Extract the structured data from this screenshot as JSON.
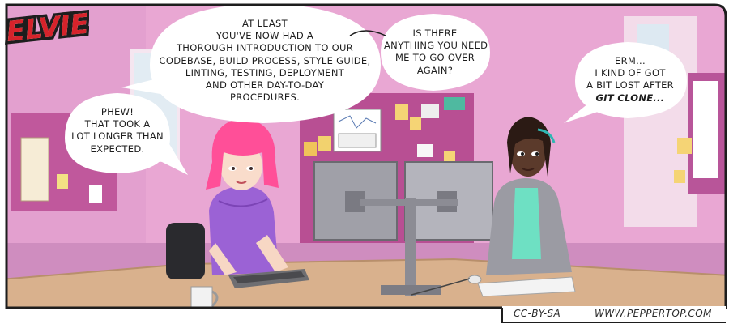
{
  "logo": {
    "text": "ELVIE",
    "color": "#d6232b"
  },
  "bubbles": {
    "elvie_phew": {
      "lines": [
        "Phew!",
        "That took a",
        "lot longer than",
        "expected."
      ]
    },
    "elvie_intro": {
      "lines": [
        "At least",
        "you've now had a",
        "thorough introduction to our",
        "codebase, build process, style guide,",
        "linting, testing, deployment",
        "and other day-to-day",
        "procedures."
      ]
    },
    "elvie_question": {
      "lines": [
        "Is there",
        "anything you need",
        "me to go over",
        "again?"
      ]
    },
    "colleague_reply": {
      "line1": "Erm...",
      "line2": "I kind of got",
      "line3": "a bit lost after",
      "line4_emph": "git clone..."
    }
  },
  "footer": {
    "license": "CC-BY-SA",
    "website": "www.peppertop.com"
  },
  "colors": {
    "wall": "#e6a1d0",
    "desk": "#d7b08d",
    "elvie_hair": "#ff4f97",
    "elvie_top": "#9a62d4",
    "colleague_blazer": "#9b9ba2",
    "colleague_top": "#6ee0c2",
    "ink": "#1d1d1d"
  }
}
